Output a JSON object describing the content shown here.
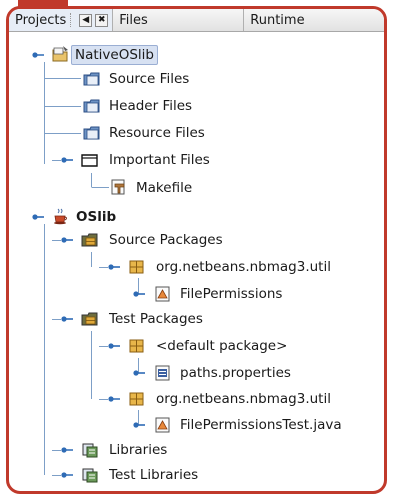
{
  "tabs": {
    "projects": "Projects",
    "files": "Files",
    "runtime": "Runtime"
  },
  "tree": {
    "native_project": "NativeOSlib",
    "source_files": "Source Files",
    "header_files": "Header Files",
    "resource_files": "Resource Files",
    "important_files": "Important Files",
    "makefile": "Makefile",
    "oslib_project": "OSlib",
    "source_packages": "Source Packages",
    "util_package": "org.netbeans.nbmag3.util",
    "file_permissions": "FilePermissions",
    "test_packages": "Test Packages",
    "default_package": "<default package>",
    "paths_properties": "paths.properties",
    "test_util_package": "org.netbeans.nbmag3.util",
    "file_permissions_test": "FilePermissionsTest.java",
    "libraries": "Libraries",
    "test_libraries": "Test Libraries"
  },
  "colors": {
    "accent_red": "#c0392b",
    "tree_line": "#3a6ea5",
    "selection": "#d7e1f2"
  },
  "icons": {
    "native_project": "project-icon",
    "source_files": "folder-icon",
    "header_files": "folder-icon",
    "resource_files": "folder-icon",
    "important_files": "folder-icon",
    "makefile": "makefile-icon",
    "oslib_project": "java-coffee-cup-icon",
    "source_packages": "source-packages-icon",
    "package": "package-icon",
    "java_class": "java-class-icon",
    "properties": "properties-file-icon",
    "libraries": "libraries-icon"
  }
}
